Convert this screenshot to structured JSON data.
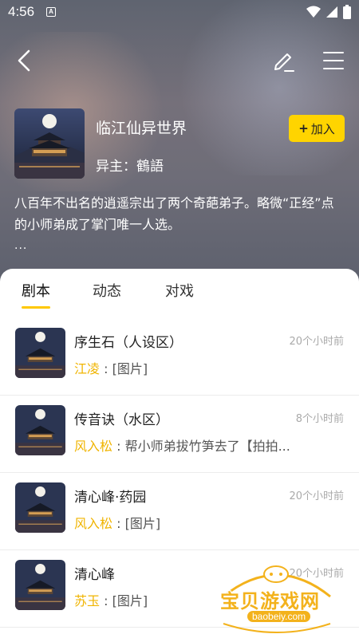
{
  "status_bar": {
    "time": "4:56",
    "notification_icon": "A"
  },
  "nav": {
    "back_icon": "chevron-left-icon",
    "edit_icon": "pencil-icon",
    "menu_icon": "hamburger-icon"
  },
  "world": {
    "name": "临江仙异世界",
    "owner": "异主：鶴語",
    "join_plus": "+",
    "join_label": "加入",
    "description": "八百年不出名的逍遥宗出了两个奇葩弟子。略微“正经”点的小师弟成了掌门唯一人选。",
    "more": "..."
  },
  "tabs": [
    {
      "label": "剧本",
      "active": true
    },
    {
      "label": "动态",
      "active": false
    },
    {
      "label": "对戏",
      "active": false
    }
  ],
  "items": [
    {
      "title": "序生石（人设区）",
      "time": "20个小时前",
      "author": "江凌",
      "message": " : [图片]"
    },
    {
      "title": "传音诀（水区）",
      "time": "8个小时前",
      "author": "风入松",
      "message": " : 帮小师弟拔竹笋去了【拍拍..."
    },
    {
      "title": "清心峰·药园",
      "time": "20个小时前",
      "author": "风入松",
      "message": " : [图片]"
    },
    {
      "title": "清心峰",
      "time": "20个小时前",
      "author": "苏玉",
      "message": " : [图片]"
    }
  ],
  "watermark": {
    "text": "宝贝游戏网",
    "url": "baobeiy.com"
  },
  "colors": {
    "accent": "#ffd400",
    "author": "#f0b400"
  }
}
